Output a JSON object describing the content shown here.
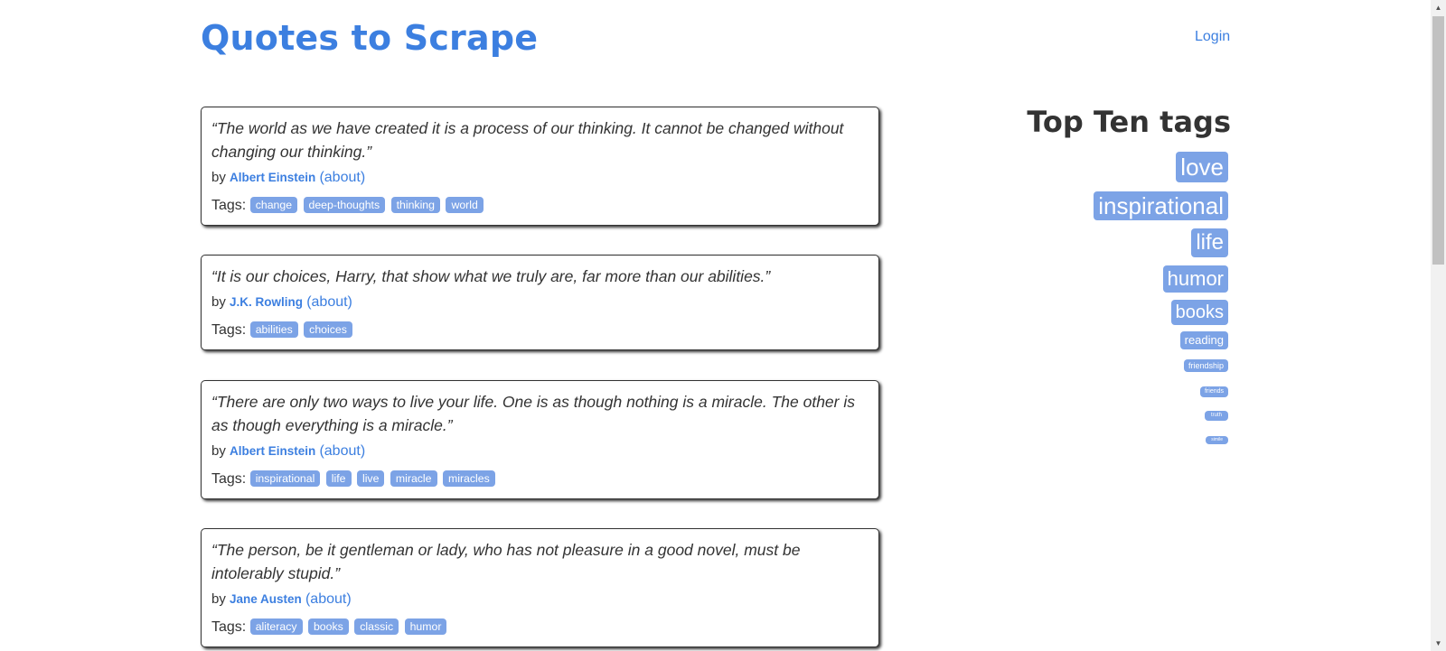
{
  "header": {
    "title": "Quotes to Scrape",
    "login_label": "Login"
  },
  "quotes": [
    {
      "text": "“The world as we have created it is a process of our thinking. It cannot be changed without changing our thinking.”",
      "by_label": "by",
      "author": "Albert Einstein",
      "about_label": "(about)",
      "tags_label": "Tags:",
      "tags": [
        "change",
        "deep-thoughts",
        "thinking",
        "world"
      ]
    },
    {
      "text": "“It is our choices, Harry, that show what we truly are, far more than our abilities.”",
      "by_label": "by",
      "author": "J.K. Rowling",
      "about_label": "(about)",
      "tags_label": "Tags:",
      "tags": [
        "abilities",
        "choices"
      ]
    },
    {
      "text": "“There are only two ways to live your life. One is as though nothing is a miracle. The other is as though everything is a miracle.”",
      "by_label": "by",
      "author": "Albert Einstein",
      "about_label": "(about)",
      "tags_label": "Tags:",
      "tags": [
        "inspirational",
        "life",
        "live",
        "miracle",
        "miracles"
      ]
    },
    {
      "text": "“The person, be it gentleman or lady, who has not pleasure in a good novel, must be intolerably stupid.”",
      "by_label": "by",
      "author": "Jane Austen",
      "about_label": "(about)",
      "tags_label": "Tags:",
      "tags": [
        "aliteracy",
        "books",
        "classic",
        "humor"
      ]
    }
  ],
  "sidebar": {
    "title": "Top Ten tags",
    "tags": [
      "love",
      "inspirational",
      "life",
      "humor",
      "books",
      "reading",
      "friendship",
      "friends",
      "truth",
      "simile"
    ]
  },
  "colors": {
    "accent": "#3c7fe0",
    "tag_bg": "#7ca3e6",
    "text": "#333333"
  },
  "icons": {
    "scroll_up": "chevron-up-icon",
    "scroll_down": "chevron-down-icon"
  }
}
